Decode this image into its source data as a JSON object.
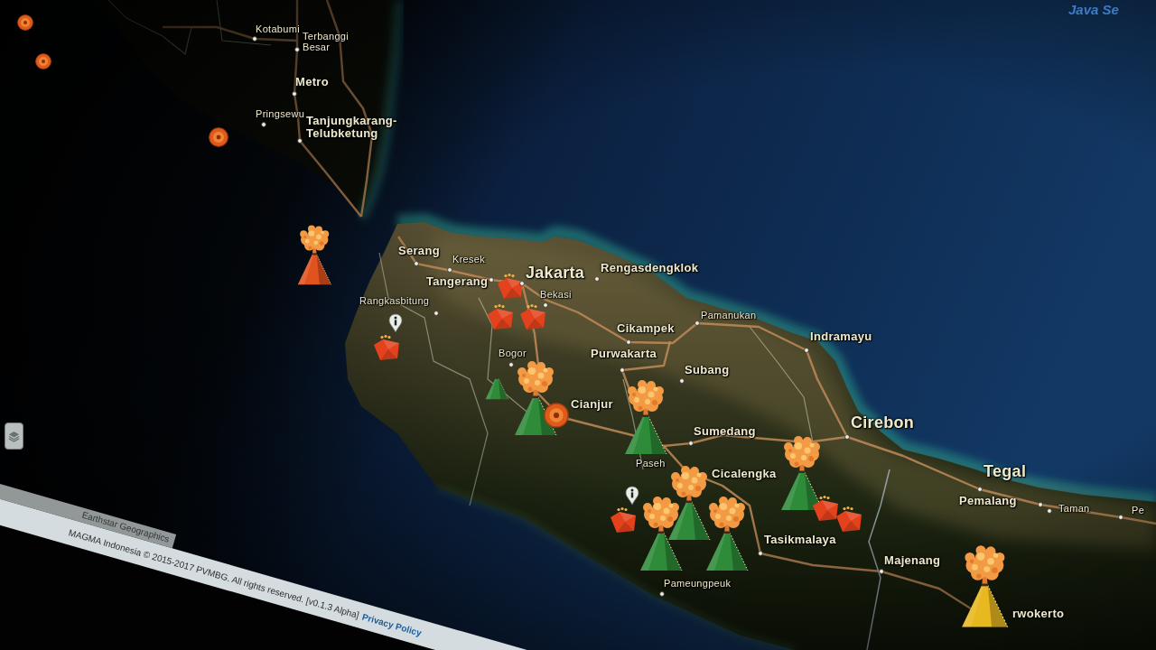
{
  "map": {
    "sea_label": "Java Se",
    "places": [
      {
        "name": "Kotabumi",
        "kind": "village"
      },
      {
        "name": "Terbanggi Besar",
        "kind": "village"
      },
      {
        "name": "Metro",
        "kind": "town"
      },
      {
        "name": "Pringsewu",
        "kind": "village"
      },
      {
        "name": "Tanjungkarang-Telubketung",
        "kind": "town"
      },
      {
        "name": "Serang",
        "kind": "town"
      },
      {
        "name": "Kresek",
        "kind": "village"
      },
      {
        "name": "Jakarta",
        "kind": "city"
      },
      {
        "name": "Rengasdengklok",
        "kind": "town"
      },
      {
        "name": "Tangerang",
        "kind": "town"
      },
      {
        "name": "Bekasi",
        "kind": "village"
      },
      {
        "name": "Rangkasbitung",
        "kind": "village"
      },
      {
        "name": "Pamanukan",
        "kind": "village"
      },
      {
        "name": "Cikampek",
        "kind": "town"
      },
      {
        "name": "Indramayu",
        "kind": "town"
      },
      {
        "name": "Bogor",
        "kind": "village"
      },
      {
        "name": "Purwakarta",
        "kind": "town"
      },
      {
        "name": "Subang",
        "kind": "town"
      },
      {
        "name": "Cianjur",
        "kind": "town"
      },
      {
        "name": "Cirebon",
        "kind": "city"
      },
      {
        "name": "Sumedang",
        "kind": "town"
      },
      {
        "name": "Paseh",
        "kind": "village"
      },
      {
        "name": "Cicalengka",
        "kind": "town"
      },
      {
        "name": "Tegal",
        "kind": "city"
      },
      {
        "name": "Pemalang",
        "kind": "town"
      },
      {
        "name": "Taman",
        "kind": "village"
      },
      {
        "name": "Pe",
        "kind": "village"
      },
      {
        "name": "Tasikmalaya",
        "kind": "town"
      },
      {
        "name": "Majenang",
        "kind": "town"
      },
      {
        "name": "Pameungpeuk",
        "kind": "village"
      },
      {
        "name": "rwokerto",
        "kind": "town"
      }
    ],
    "markers": [
      {
        "kind": "earthquake"
      },
      {
        "kind": "earthquake"
      },
      {
        "kind": "earthquake"
      },
      {
        "kind": "volcano",
        "color": "#e0521e",
        "erupting": true
      },
      {
        "kind": "ground-movement",
        "info": false
      },
      {
        "kind": "ground-movement",
        "info": false
      },
      {
        "kind": "ground-movement",
        "info": false
      },
      {
        "kind": "ground-movement",
        "info": true
      },
      {
        "kind": "volcano",
        "color": "#2e8b3a",
        "erupting": false
      },
      {
        "kind": "volcano",
        "color": "#2e8b3a",
        "erupting": true
      },
      {
        "kind": "earthquake"
      },
      {
        "kind": "volcano",
        "color": "#2e8b3a",
        "erupting": true
      },
      {
        "kind": "volcano",
        "color": "#2e8b3a",
        "erupting": true
      },
      {
        "kind": "volcano",
        "color": "#2e8b3a",
        "erupting": true
      },
      {
        "kind": "ground-movement",
        "info": true
      },
      {
        "kind": "volcano",
        "color": "#2e8b3a",
        "erupting": true
      },
      {
        "kind": "volcano",
        "color": "#2e8b3a",
        "erupting": true
      },
      {
        "kind": "ground-movement",
        "info": false
      },
      {
        "kind": "ground-movement",
        "info": false
      },
      {
        "kind": "volcano",
        "color": "#e8b820",
        "erupting": true
      }
    ]
  },
  "attribution": "Earthstar Geographics",
  "footer": {
    "copyright": "MAGMA Indonesia © 2015-2017 PVMBG. All rights reserved. [v0.1.3 Alpha]",
    "link": "Privacy Policy"
  }
}
